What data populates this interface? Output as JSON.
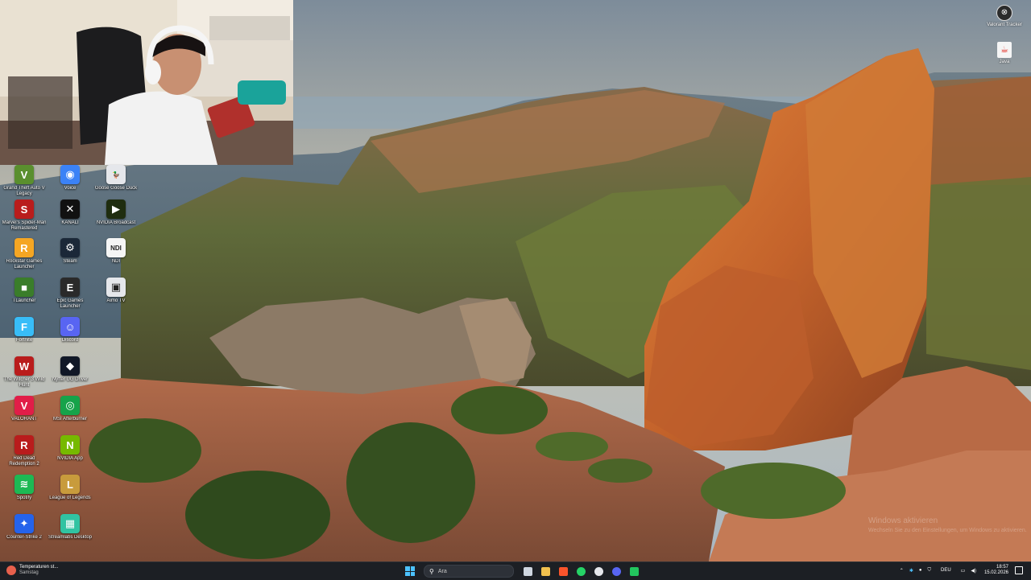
{
  "desktop_icons": [
    {
      "label": "Grand Theft Auto V Legacy",
      "icon": "gta-v-icon",
      "color": "#5a8f2e",
      "glyph": "V"
    },
    {
      "label": "Voice",
      "icon": "voice-icon",
      "color": "#3b82f6",
      "glyph": "◉"
    },
    {
      "label": "Goose Goose Duck",
      "icon": "goose-goose-duck-icon",
      "color": "#e5e7eb",
      "glyph": "🦆"
    },
    {
      "label": "Marvel's Spider-Man Remastered",
      "icon": "spider-man-icon",
      "color": "#b91c1c",
      "glyph": "S"
    },
    {
      "label": "KANALI",
      "icon": "kanali-icon",
      "color": "#111111",
      "glyph": "✕"
    },
    {
      "label": "NVIDIA Broadcast",
      "icon": "nvidia-broadcast-icon",
      "color": "#1f2d0f",
      "glyph": "▶"
    },
    {
      "label": "Rockstar Games Launcher",
      "icon": "rockstar-icon",
      "color": "#f5a623",
      "glyph": "R"
    },
    {
      "label": "Steam",
      "icon": "steam-icon",
      "color": "#1b2838",
      "glyph": "⚙"
    },
    {
      "label": "NDI",
      "icon": "ndi-icon",
      "color": "#f5f5f5",
      "glyph": "NDI"
    },
    {
      "label": "TLauncher",
      "icon": "tlauncher-icon",
      "color": "#3a7d2a",
      "glyph": "■"
    },
    {
      "label": "Epic Games Launcher",
      "icon": "epic-games-icon",
      "color": "#2a2a2a",
      "glyph": "E"
    },
    {
      "label": "Aimo TV",
      "icon": "aimo-tv-icon",
      "color": "#e5e7eb",
      "glyph": "▣"
    },
    {
      "label": "Fortnite",
      "icon": "fortnite-icon",
      "color": "#38bdf8",
      "glyph": "F"
    },
    {
      "label": "Discord",
      "icon": "discord-icon",
      "color": "#5865f2",
      "glyph": "☺"
    },
    {
      "label": "The Witcher 3 Wild Hunt",
      "icon": "witcher-icon",
      "color": "#b91c1c",
      "glyph": "W"
    },
    {
      "label": "Nyfter UG Driver",
      "icon": "nyfter-icon",
      "color": "#111827",
      "glyph": "◆"
    },
    {
      "label": "VALORANT",
      "icon": "valorant-icon",
      "color": "#e11d48",
      "glyph": "V"
    },
    {
      "label": "MSI Afterburner",
      "icon": "msi-afterburner-icon",
      "color": "#16a34a",
      "glyph": "◎"
    },
    {
      "label": "Red Dead Redemption 2",
      "icon": "rdr2-icon",
      "color": "#b91c1c",
      "glyph": "R"
    },
    {
      "label": "NVIDIA App",
      "icon": "nvidia-app-icon",
      "color": "#76b900",
      "glyph": "N"
    },
    {
      "label": "Spotify",
      "icon": "spotify-icon",
      "color": "#1db954",
      "glyph": "≋"
    },
    {
      "label": "League of Legends",
      "icon": "league-of-legends-icon",
      "color": "#c89b3c",
      "glyph": "L"
    },
    {
      "label": "Counter-Strike 2",
      "icon": "counter-strike-icon",
      "color": "#2563eb",
      "glyph": "✦"
    },
    {
      "label": "Streamlabs Desktop",
      "icon": "streamlabs-icon",
      "color": "#31c3a2",
      "glyph": "▦"
    }
  ],
  "right_icons": [
    {
      "label": "Valorant Tracker",
      "icon": "tracker-icon"
    },
    {
      "label": "Java",
      "icon": "java-icon"
    }
  ],
  "watermark": {
    "title": "Windows aktivieren",
    "subtitle": "Wechseln Sie zu den Einstellungen, um Windows zu aktivieren."
  },
  "taskbar": {
    "weather_title": "Temperaturen st...",
    "weather_sub": "Samstag",
    "search_placeholder": "Ara",
    "pinned": [
      {
        "icon": "task-view-icon",
        "color": "#cfd6e0"
      },
      {
        "icon": "file-explorer-icon",
        "color": "#f2c14e"
      },
      {
        "icon": "brave-browser-icon",
        "color": "#fb542b"
      },
      {
        "icon": "whatsapp-icon",
        "color": "#25d366"
      },
      {
        "icon": "obs-icon",
        "color": "#e5e7eb"
      },
      {
        "icon": "discord-taskbar-icon",
        "color": "#5865f2"
      },
      {
        "icon": "launcher-taskbar-icon",
        "color": "#22c55e"
      }
    ],
    "lang": "DEU",
    "time": "18:57",
    "date": "15.02.2026"
  }
}
